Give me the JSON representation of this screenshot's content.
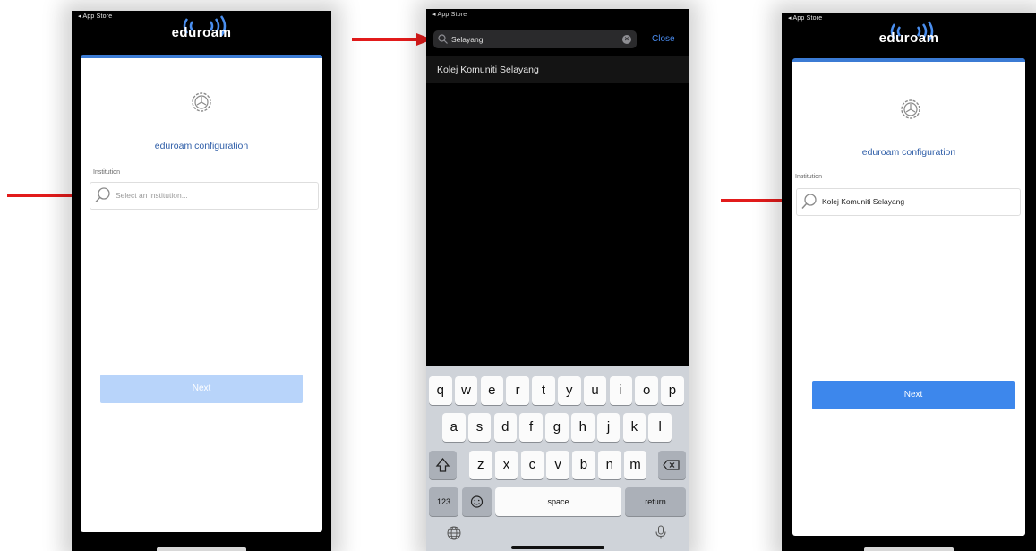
{
  "screens": {
    "left": {
      "status": "◂ App Store",
      "logo_text": "eduroam",
      "gear_icon": "gear-icon",
      "title": "eduroam configuration",
      "institution_label": "Institution",
      "institution_placeholder": "Select an institution...",
      "next_label": "Next",
      "next_state": "disabled"
    },
    "middle": {
      "status": "◂ App Store",
      "search_value": "Selayang",
      "close_label": "Close",
      "result": "Kolej Komuniti Selayang",
      "keyboard": {
        "row1": [
          "q",
          "w",
          "e",
          "r",
          "t",
          "y",
          "u",
          "i",
          "o",
          "p"
        ],
        "row2": [
          "a",
          "s",
          "d",
          "f",
          "g",
          "h",
          "j",
          "k",
          "l"
        ],
        "row3": [
          "z",
          "x",
          "c",
          "v",
          "b",
          "n",
          "m"
        ],
        "numbers_key": "123",
        "space_key": "space",
        "return_key": "return"
      }
    },
    "right": {
      "status": "◂ App Store",
      "logo_text": "eduroam",
      "title": "eduroam configuration",
      "institution_label": "Institution",
      "institution_value": "Kolej Komuniti Selayang",
      "next_label": "Next",
      "next_state": "enabled"
    }
  },
  "colors": {
    "accent": "#3d87ec",
    "disabled_button": "#b8d4fa",
    "card_top_border": "#3b7bd4",
    "title_text": "#2f5ea8",
    "arrow": "#e21b1b",
    "close_link": "#4a8cf0"
  }
}
